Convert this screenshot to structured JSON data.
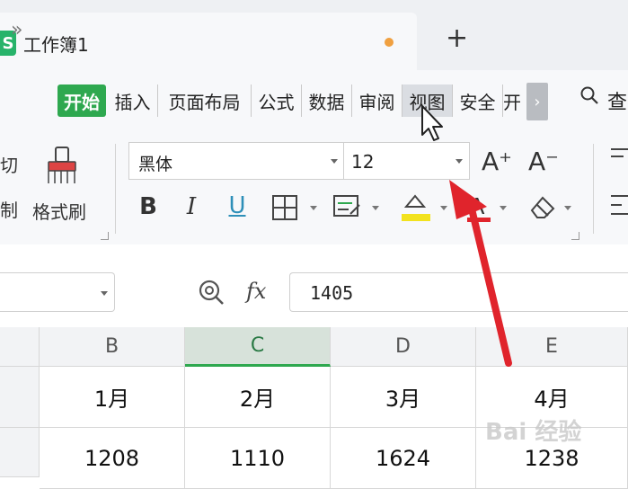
{
  "tabbar": {
    "app_icon_glyph": "S",
    "doc_title": "工作簿1",
    "new_tab_glyph": "+"
  },
  "menu": {
    "more_glyph": "»",
    "tabs": [
      {
        "label": "开始"
      },
      {
        "label": "插入"
      },
      {
        "label": "页面布局"
      },
      {
        "label": "公式"
      },
      {
        "label": "数据"
      },
      {
        "label": "审阅"
      },
      {
        "label": "视图"
      },
      {
        "label": "安全"
      },
      {
        "label": "开"
      }
    ],
    "next_glyph": "›",
    "search_label": "查"
  },
  "ribbon": {
    "cut_label": "切",
    "copy_label": "制",
    "format_painter_label": "格式刷",
    "font_name": "黑体",
    "font_size": "12",
    "grow_font": "A⁺",
    "shrink_font": "A⁻",
    "bold": "B",
    "italic": "I",
    "underline": "U"
  },
  "formula_bar": {
    "fx_label": "fx",
    "value": "1405"
  },
  "grid": {
    "columns": [
      "B",
      "C",
      "D",
      "E"
    ],
    "selected_column": "C",
    "rows": [
      [
        "1月",
        "2月",
        "3月",
        "4月"
      ],
      [
        "1208",
        "1110",
        "1624",
        "1238"
      ]
    ]
  },
  "watermark": "Bai 经验",
  "colors": {
    "accent": "#2ea84f",
    "annotation_arrow": "#e0242c"
  }
}
